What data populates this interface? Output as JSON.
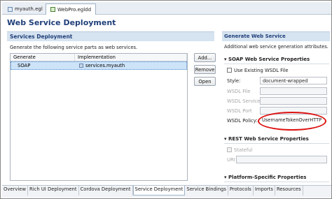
{
  "editor_tabs": [
    {
      "label": "myauth.egl",
      "closable": true
    },
    {
      "label": "WebPro.egldd",
      "closable": true,
      "active": true
    }
  ],
  "page_title": "Web Service Deployment",
  "services_deployment": {
    "header": "Services Deployment",
    "description": "Generate the following service parts as web services.",
    "columns": [
      "Generate",
      "Implementation"
    ],
    "rows": [
      {
        "generate": "SOAP",
        "implementation": "services.myauth",
        "selected": true
      }
    ],
    "buttons": {
      "add": "Add...",
      "remove": "Remove",
      "open": "Open"
    }
  },
  "generate_web_service": {
    "header": "Generate Web Service",
    "description": "Additional web service generation attributes."
  },
  "soap_properties": {
    "title": "SOAP Web Service Properties",
    "use_existing_wsdl_label": "Use Existing WSDL File",
    "style_label": "Style:",
    "style_value": "document-wrapped",
    "wsdl_file_label": "WSDL File",
    "wsdl_service_label": "WSDL Service",
    "wsdl_port_label": "WSDL Port",
    "wsdl_policy_label": "WSDL Policy:",
    "wsdl_policy_value": "UsernameTokenOverHTTP",
    "highlight_color": "#dd1111"
  },
  "rest_properties": {
    "title": "REST Web Service Properties",
    "stateful_label": "Stateful",
    "uri_label": "URI"
  },
  "platform_properties": {
    "title": "Platform-Specific Properties"
  },
  "bottom_tabs": [
    {
      "label": "Overview"
    },
    {
      "label": "Rich UI Deployment"
    },
    {
      "label": "Cordova Deployment"
    },
    {
      "label": "Service Deployment",
      "active": true
    },
    {
      "label": "Service Bindings"
    },
    {
      "label": "Protocols"
    },
    {
      "label": "Imports"
    },
    {
      "label": "Resources"
    }
  ]
}
